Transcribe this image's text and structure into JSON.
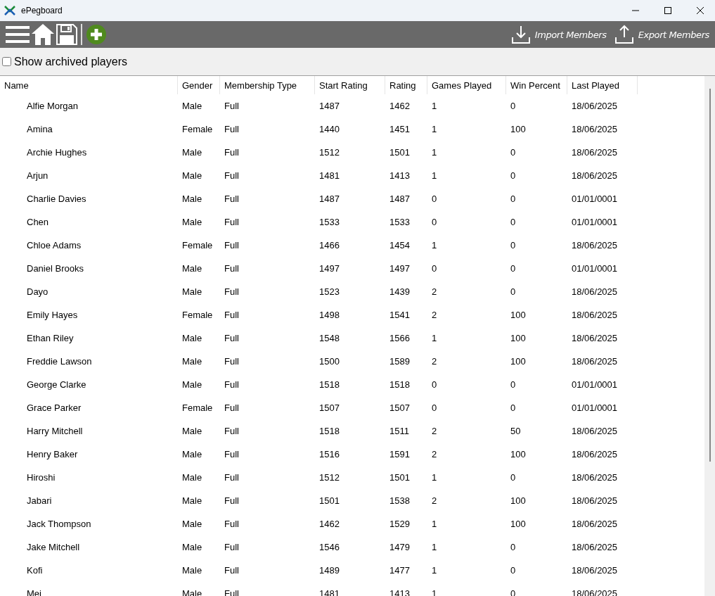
{
  "window": {
    "title": "ePegboard"
  },
  "toolbar": {
    "import_label": "Import Members",
    "export_label": "Export Members"
  },
  "filter": {
    "label": "Show archived players",
    "checked": false
  },
  "table": {
    "columns": [
      "Name",
      "Gender",
      "Membership Type",
      "Start Rating",
      "Rating",
      "Games Played",
      "Win Percent",
      "Last Played"
    ],
    "rows": [
      [
        "Alfie Morgan",
        "Male",
        "Full",
        "1487",
        "1462",
        "1",
        "0",
        "18/06/2025"
      ],
      [
        "Amina",
        "Female",
        "Full",
        "1440",
        "1451",
        "1",
        "100",
        "18/06/2025"
      ],
      [
        "Archie Hughes",
        "Male",
        "Full",
        "1512",
        "1501",
        "1",
        "0",
        "18/06/2025"
      ],
      [
        "Arjun",
        "Male",
        "Full",
        "1481",
        "1413",
        "1",
        "0",
        "18/06/2025"
      ],
      [
        "Charlie Davies",
        "Male",
        "Full",
        "1487",
        "1487",
        "0",
        "0",
        "01/01/0001"
      ],
      [
        "Chen",
        "Male",
        "Full",
        "1533",
        "1533",
        "0",
        "0",
        "01/01/0001"
      ],
      [
        "Chloe Adams",
        "Female",
        "Full",
        "1466",
        "1454",
        "1",
        "0",
        "18/06/2025"
      ],
      [
        "Daniel Brooks",
        "Male",
        "Full",
        "1497",
        "1497",
        "0",
        "0",
        "01/01/0001"
      ],
      [
        "Dayo",
        "Male",
        "Full",
        "1523",
        "1439",
        "2",
        "0",
        "18/06/2025"
      ],
      [
        "Emily Hayes",
        "Female",
        "Full",
        "1498",
        "1541",
        "2",
        "100",
        "18/06/2025"
      ],
      [
        "Ethan Riley",
        "Male",
        "Full",
        "1548",
        "1566",
        "1",
        "100",
        "18/06/2025"
      ],
      [
        "Freddie Lawson",
        "Male",
        "Full",
        "1500",
        "1589",
        "2",
        "100",
        "18/06/2025"
      ],
      [
        "George Clarke",
        "Male",
        "Full",
        "1518",
        "1518",
        "0",
        "0",
        "01/01/0001"
      ],
      [
        "Grace Parker",
        "Female",
        "Full",
        "1507",
        "1507",
        "0",
        "0",
        "01/01/0001"
      ],
      [
        "Harry Mitchell",
        "Male",
        "Full",
        "1518",
        "1511",
        "2",
        "50",
        "18/06/2025"
      ],
      [
        "Henry Baker",
        "Male",
        "Full",
        "1516",
        "1591",
        "2",
        "100",
        "18/06/2025"
      ],
      [
        "Hiroshi",
        "Male",
        "Full",
        "1512",
        "1501",
        "1",
        "0",
        "18/06/2025"
      ],
      [
        "Jabari",
        "Male",
        "Full",
        "1501",
        "1538",
        "2",
        "100",
        "18/06/2025"
      ],
      [
        "Jack Thompson",
        "Male",
        "Full",
        "1462",
        "1529",
        "1",
        "100",
        "18/06/2025"
      ],
      [
        "Jake Mitchell",
        "Male",
        "Full",
        "1546",
        "1479",
        "1",
        "0",
        "18/06/2025"
      ],
      [
        "Kofi",
        "Male",
        "Full",
        "1489",
        "1477",
        "1",
        "0",
        "18/06/2025"
      ],
      [
        "Mei",
        "Male",
        "Full",
        "1481",
        "1413",
        "1",
        "0",
        "18/06/2025"
      ]
    ]
  }
}
